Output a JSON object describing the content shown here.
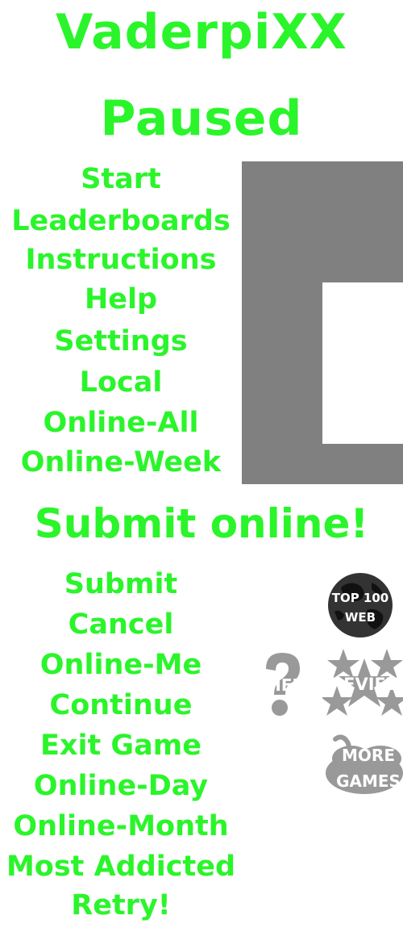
{
  "header": {
    "game_title": "VaderpiXX",
    "state": "Paused"
  },
  "menu_top": [
    "Start",
    "Leaderboards",
    "Instructions",
    "Help",
    "Settings",
    "Local",
    "Online-All",
    "Online-Week"
  ],
  "submit_heading": "Submit online!",
  "menu_bottom": [
    "Submit",
    "Cancel",
    "Online-Me",
    "Continue",
    "Exit Game",
    "Online-Day",
    "Online-Month",
    "Most Addicted",
    "Retry!"
  ],
  "icons": {
    "top100": {
      "name": "globe-icon",
      "line1": "TOP 100",
      "line2": "WEB"
    },
    "help": {
      "name": "question-mark-icon",
      "label": "HELP"
    },
    "review": {
      "name": "stars-icon",
      "label": "REVIEW"
    },
    "more_games": {
      "name": "joystick-cloud-icon",
      "line1": "MORE",
      "line2": "GAMES"
    }
  },
  "colors": {
    "text_green": "#2af52a",
    "panel_gray": "#808080",
    "icon_gray": "#999999",
    "globe_dark": "#333333"
  }
}
